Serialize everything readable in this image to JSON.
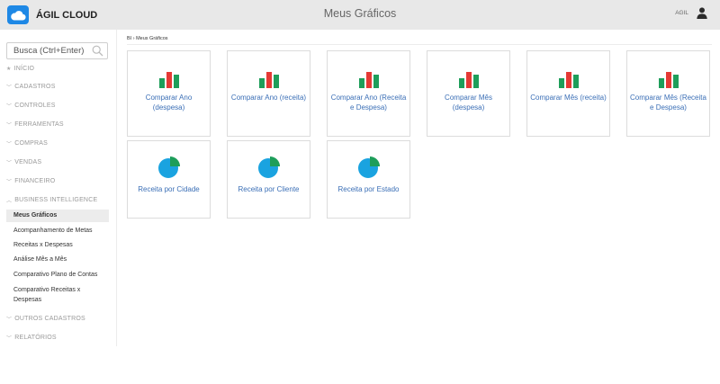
{
  "header": {
    "app_name": "ÁGIL CLOUD",
    "page_title": "Meus Gráficos",
    "user_name": "AGIL"
  },
  "sidebar": {
    "search_placeholder": "Busca (Ctrl+Enter)",
    "sections": {
      "inicio": "INÍCIO",
      "cadastros": "CADASTROS",
      "controles": "CONTROLES",
      "ferramentas": "FERRAMENTAS",
      "compras": "COMPRAS",
      "vendas": "VENDAS",
      "financeiro": "FINANCEIRO",
      "bi": "BUSINESS INTELLIGENCE",
      "outros": "OUTROS CADASTROS",
      "relatorios": "RELATÓRIOS"
    },
    "bi_items": [
      "Meus Gráficos",
      "Acompanhamento de Metas",
      "Receitas x Despesas",
      "Análise Mês a Mês",
      "Comparativo Plano de Contas",
      "Comparativo Receitas x Despesas"
    ]
  },
  "breadcrumb": "BI › Meus Gráficos",
  "cards": [
    {
      "icon": "bar-chart-icon",
      "label": "Comparar Ano (despesa)"
    },
    {
      "icon": "bar-chart-icon",
      "label": "Comparar Ano (receita)"
    },
    {
      "icon": "bar-chart-icon",
      "label": "Comparar Ano (Receita e Despesa)"
    },
    {
      "icon": "bar-chart-icon",
      "label": "Comparar Mês (despesa)"
    },
    {
      "icon": "bar-chart-icon",
      "label": "Comparar Mês (receita)"
    },
    {
      "icon": "bar-chart-icon",
      "label": "Comparar Mês (Receita e Despesa)"
    },
    {
      "icon": "pie-chart-icon",
      "label": "Receita por Cidade"
    },
    {
      "icon": "pie-chart-icon",
      "label": "Receita por Cliente"
    },
    {
      "icon": "pie-chart-icon",
      "label": "Receita por Estado"
    }
  ],
  "colors": {
    "brand": "#1e88e5",
    "bar_red": "#e53935",
    "bar_green": "#1e9e5a",
    "pie_blue": "#1aa3e0",
    "pie_green": "#1e9e5a",
    "link": "#3b6fb6"
  }
}
